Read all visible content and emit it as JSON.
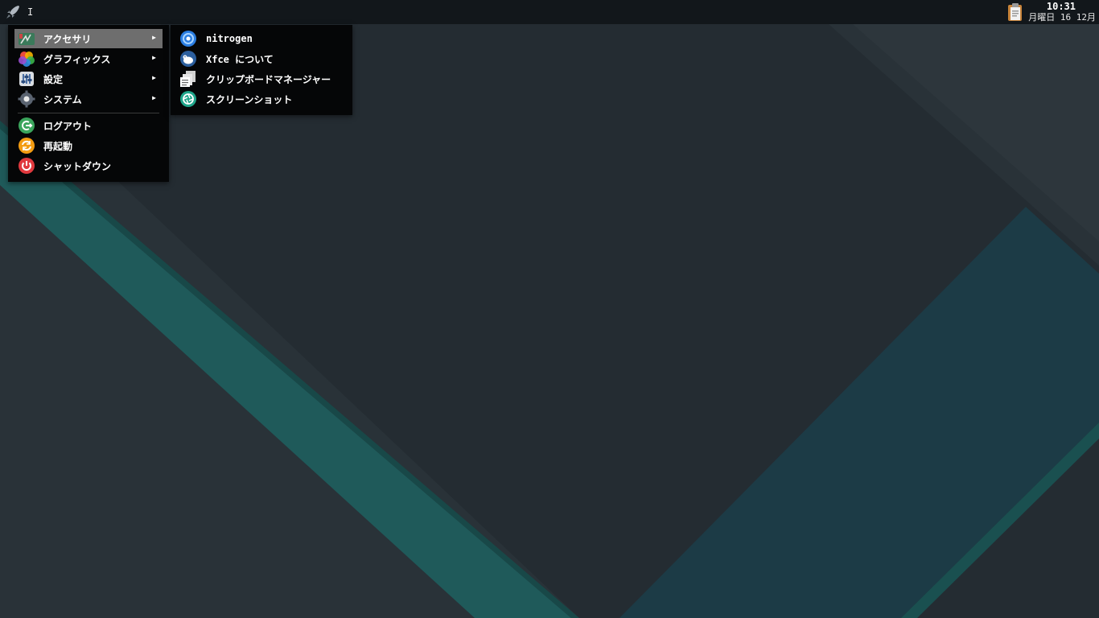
{
  "panel": {
    "workspace_label": "I",
    "clock": {
      "time": "10:31",
      "date": "月曜日 16 12月"
    }
  },
  "main_menu": {
    "items": [
      {
        "label": "アクセサリ",
        "icon": "accessories-icon",
        "submenu": true,
        "active": true
      },
      {
        "label": "グラフィックス",
        "icon": "graphics-icon",
        "submenu": true
      },
      {
        "label": "設定",
        "icon": "settings-icon",
        "submenu": true
      },
      {
        "label": "システム",
        "icon": "system-icon",
        "submenu": true
      }
    ],
    "session_items": [
      {
        "label": "ログアウト",
        "icon": "logout-icon"
      },
      {
        "label": "再起動",
        "icon": "restart-icon"
      },
      {
        "label": "シャットダウン",
        "icon": "shutdown-icon"
      }
    ],
    "submenu_arrow": "▶"
  },
  "sub_menu": {
    "items": [
      {
        "label": "nitrogen",
        "icon": "nitrogen-icon"
      },
      {
        "label": "Xfce について",
        "icon": "xfce-icon"
      },
      {
        "label": "クリップボードマネージャー",
        "icon": "clipboard-manager-icon"
      },
      {
        "label": "スクリーンショット",
        "icon": "screenshot-icon"
      }
    ]
  },
  "colors": {
    "panel_bg": "#12171b",
    "menu_bg": "#050607",
    "active_item": "#6e6e6e",
    "wallpaper_teal": "#1f5a5a"
  }
}
